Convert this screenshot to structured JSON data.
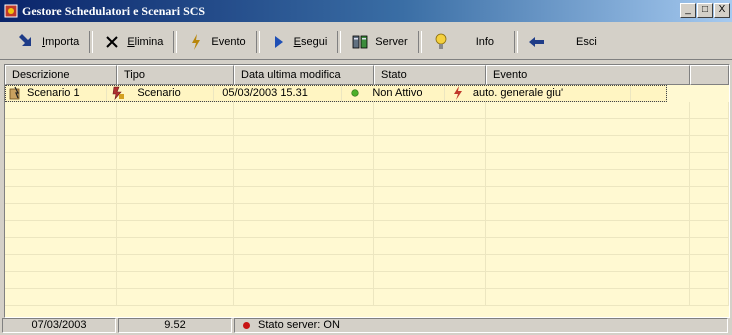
{
  "window": {
    "title": "Gestore Schedulatori e Scenari SCS"
  },
  "title_buttons": [
    "_",
    "□",
    "X"
  ],
  "toolbar": {
    "items": [
      {
        "label": "Importa",
        "icon": "import-arrow-icon"
      },
      {
        "label": "Elimina",
        "icon": "delete-x-icon"
      },
      {
        "label": "Evento",
        "icon": "event-lightning-icon"
      },
      {
        "label": "Esegui",
        "icon": "play-triangle-icon"
      },
      {
        "label": "Server",
        "icon": "server-icon"
      },
      {
        "label": "Info",
        "icon": "info-lightbulb-icon"
      },
      {
        "label": "Esci",
        "icon": "exit-arrow-icon"
      }
    ]
  },
  "grid": {
    "columns": [
      "Descrizione",
      "Tipo",
      "Data ultima modifica",
      "Stato",
      "Evento",
      ""
    ],
    "rows": [
      {
        "descrizione": "Scenario 1",
        "tipo": "Scenario",
        "data": "05/03/2003 15.31",
        "stato": "Non Attivo",
        "evento": "auto. generale giu'"
      }
    ],
    "empty_rows": 12
  },
  "status": {
    "date": "07/03/2003",
    "time": "9.52",
    "server": "Stato server: ON"
  },
  "colors": {
    "row_background": "#fff9d2",
    "status_ok": "#4caf2a",
    "status_server": "#c81414"
  }
}
